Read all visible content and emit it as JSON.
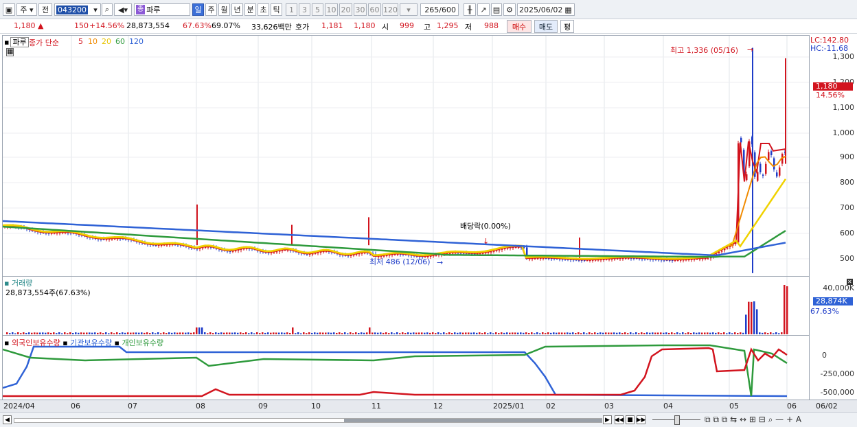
{
  "toolbar": {
    "market": "주",
    "prev": "전",
    "code": "043200",
    "name_tag": "종",
    "name": "파루",
    "periods": [
      "일",
      "주",
      "월",
      "년",
      "분",
      "초",
      "틱"
    ],
    "numbers": [
      "1",
      "3",
      "5",
      "10",
      "20",
      "30",
      "60",
      "120"
    ],
    "count": "265",
    "count_total": "/600",
    "date": "2025/06/02"
  },
  "quote": {
    "price": "1,180",
    "change": "150",
    "change_pct": "+14.56%",
    "volume": "28,873,554",
    "turnover_pct": "67.63%",
    "pct2": "69.07%",
    "amount": "33,626백만",
    "hoga_label": "호가",
    "ask": "1,181",
    "bid": "1,180",
    "open_label": "시",
    "open": "999",
    "high_label": "고",
    "high": "1,295",
    "low_label": "저",
    "low": "988",
    "buy": "매수",
    "sell": "매도",
    "eval": "평"
  },
  "price_panel": {
    "stock_tag": "파루",
    "legend_title": "종가 단순",
    "ma": [
      {
        "label": "5",
        "color": "#d2141e"
      },
      {
        "label": "10",
        "color": "#f08a00"
      },
      {
        "label": "20",
        "color": "#f0d200"
      },
      {
        "label": "60",
        "color": "#2e9a3c"
      },
      {
        "label": "120",
        "color": "#2f62d6"
      }
    ],
    "lc": "LC:142.80",
    "hc": "HC:-11.68",
    "high_note": "최고 1,336 (05/16)",
    "low_note": "최저 486 (12/06)",
    "dividend_note": "배당락(0.00%)",
    "axis": [
      "1,300",
      "1,200",
      "1,100",
      "1,000",
      "900",
      "800",
      "700",
      "600",
      "500"
    ],
    "cur_price": "1,180",
    "cur_pct": "14.56%"
  },
  "volume_panel": {
    "title": "거래량",
    "value": "28,873,554주(67.63%)",
    "axis_top": "40,000K",
    "cur": "28,874K",
    "cur_pct": "67.63%"
  },
  "holding_panel": {
    "legend": [
      {
        "label": "외국인보유수량",
        "color": "#d2141e"
      },
      {
        "label": "기관보유수량",
        "color": "#2f62d6"
      },
      {
        "label": "개인보유수량",
        "color": "#2e9a3c"
      }
    ],
    "axis": [
      "0",
      "-250,000",
      "-500,000"
    ]
  },
  "xaxis": [
    "2024/04",
    "06",
    "07",
    "08",
    "09",
    "10",
    "11",
    "12",
    "2025/01",
    "02",
    "03",
    "04",
    "05",
    "06",
    "06/02"
  ],
  "colors": {
    "up": "#d2141e",
    "down": "#1e3cc8",
    "accent": "#3b6fd8"
  }
}
